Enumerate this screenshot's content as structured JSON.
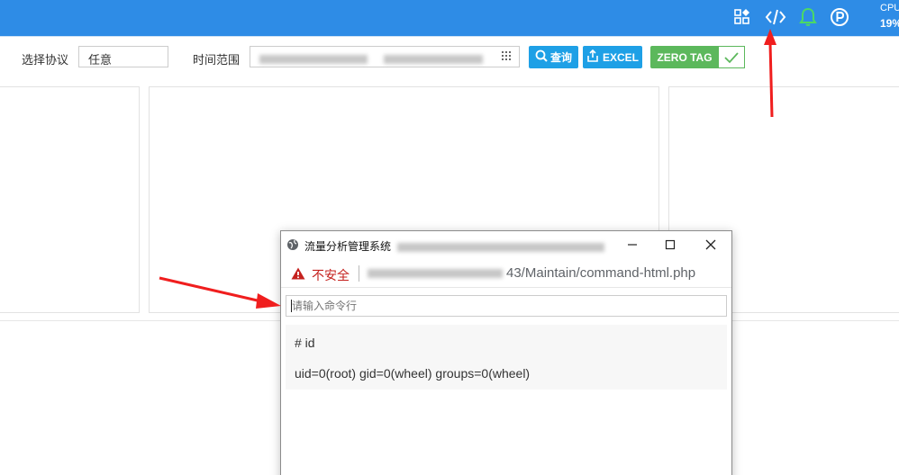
{
  "topbar": {
    "icons": [
      "grid-diamond-icon",
      "code-icon",
      "bell-icon",
      "p-circle-icon"
    ],
    "cpu_label": "CPU",
    "cpu_value": "19%"
  },
  "filters": {
    "protocol_label": "选择协议",
    "protocol_value": "任意",
    "time_label": "时间范围",
    "query_button": "查询",
    "excel_button": "EXCEL",
    "zero_tag_button": "ZERO TAG"
  },
  "popup": {
    "title": "流量分析管理系统",
    "security_label": "不安全",
    "url_path": "43/Maintain/command-html.php",
    "command_placeholder": "请输入命令行",
    "output_lines": [
      "# id",
      "uid=0(root) gid=0(wheel) groups=0(wheel)"
    ]
  },
  "colors": {
    "topbar": "#2e8ce6",
    "button_blue": "#1ea0e6",
    "button_green": "#5cb85c",
    "bell": "#4cd964",
    "warning": "#c5221f",
    "arrow": "#f01e1e"
  }
}
